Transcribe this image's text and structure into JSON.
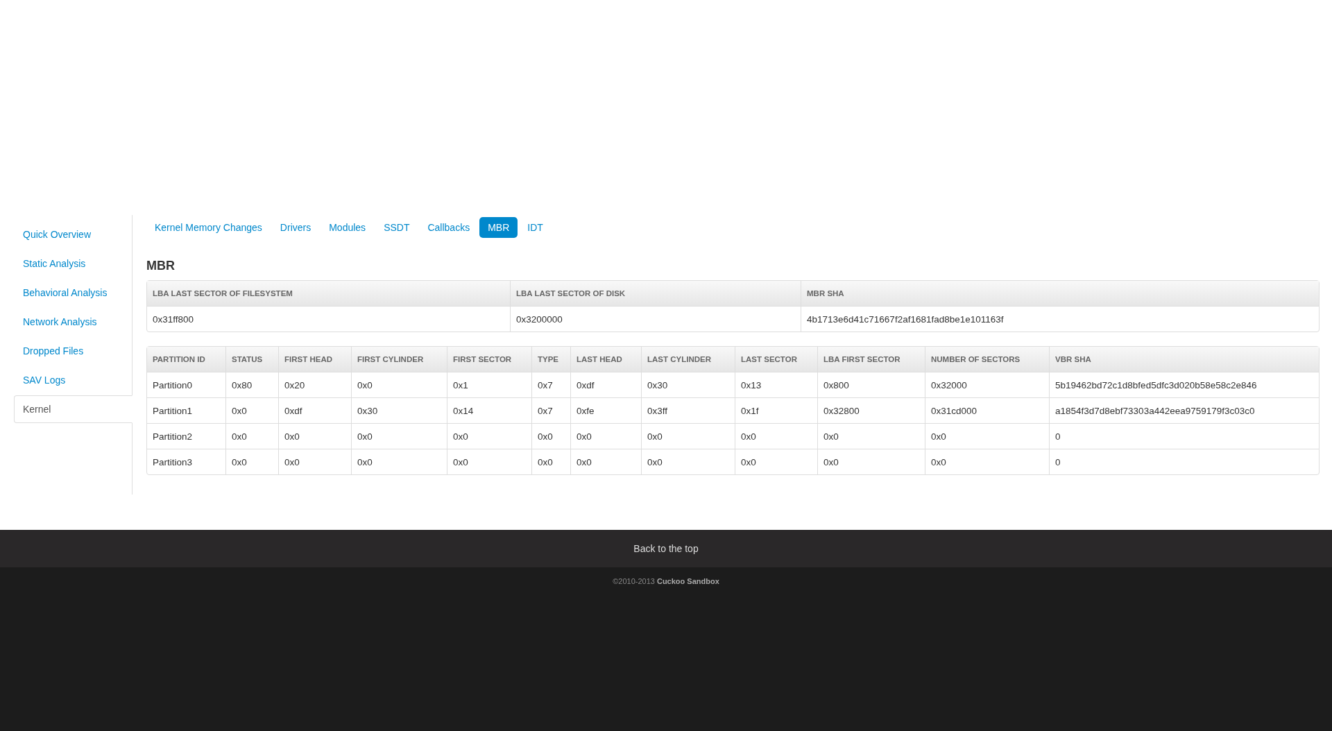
{
  "sidebar": {
    "items": [
      {
        "label": "Quick Overview",
        "selected": false
      },
      {
        "label": "Static Analysis",
        "selected": false
      },
      {
        "label": "Behavioral Analysis",
        "selected": false
      },
      {
        "label": "Network Analysis",
        "selected": false
      },
      {
        "label": "Dropped Files",
        "selected": false
      },
      {
        "label": "SAV Logs",
        "selected": false
      },
      {
        "label": "Kernel",
        "selected": true
      }
    ]
  },
  "tabs": [
    {
      "label": "Kernel Memory Changes",
      "selected": false
    },
    {
      "label": "Drivers",
      "selected": false
    },
    {
      "label": "Modules",
      "selected": false
    },
    {
      "label": "SSDT",
      "selected": false
    },
    {
      "label": "Callbacks",
      "selected": false
    },
    {
      "label": "MBR",
      "selected": true
    },
    {
      "label": "IDT",
      "selected": false
    }
  ],
  "heading": "MBR",
  "mbr_table": {
    "columns": [
      "LBA LAST SECTOR OF FILESYSTEM",
      "LBA LAST SECTOR OF DISK",
      "MBR SHA"
    ],
    "rows": [
      [
        "0x31ff800",
        "0x3200000",
        "4b1713e6d41c71667f2af1681fad8be1e101163f"
      ]
    ]
  },
  "partition_table": {
    "columns": [
      "PARTITION ID",
      "STATUS",
      "FIRST HEAD",
      "FIRST CYLINDER",
      "FIRST SECTOR",
      "TYPE",
      "LAST HEAD",
      "LAST CYLINDER",
      "LAST SECTOR",
      "LBA FIRST SECTOR",
      "NUMBER OF SECTORS",
      "VBR SHA"
    ],
    "rows": [
      [
        "Partition0",
        "0x80",
        "0x20",
        "0x0",
        "0x1",
        "0x7",
        "0xdf",
        "0x30",
        "0x13",
        "0x800",
        "0x32000",
        "5b19462bd72c1d8bfed5dfc3d020b58e58c2e846"
      ],
      [
        "Partition1",
        "0x0",
        "0xdf",
        "0x30",
        "0x14",
        "0x7",
        "0xfe",
        "0x3ff",
        "0x1f",
        "0x32800",
        "0x31cd000",
        "a1854f3d7d8ebf73303a442eea9759179f3c03c0"
      ],
      [
        "Partition2",
        "0x0",
        "0x0",
        "0x0",
        "0x0",
        "0x0",
        "0x0",
        "0x0",
        "0x0",
        "0x0",
        "0x0",
        "0"
      ],
      [
        "Partition3",
        "0x0",
        "0x0",
        "0x0",
        "0x0",
        "0x0",
        "0x0",
        "0x0",
        "0x0",
        "0x0",
        "0x0",
        "0"
      ]
    ]
  },
  "footer": {
    "back_link": "Back to the top",
    "copyright": "©2010-2013 **Cuckoo Sandbox**"
  }
}
